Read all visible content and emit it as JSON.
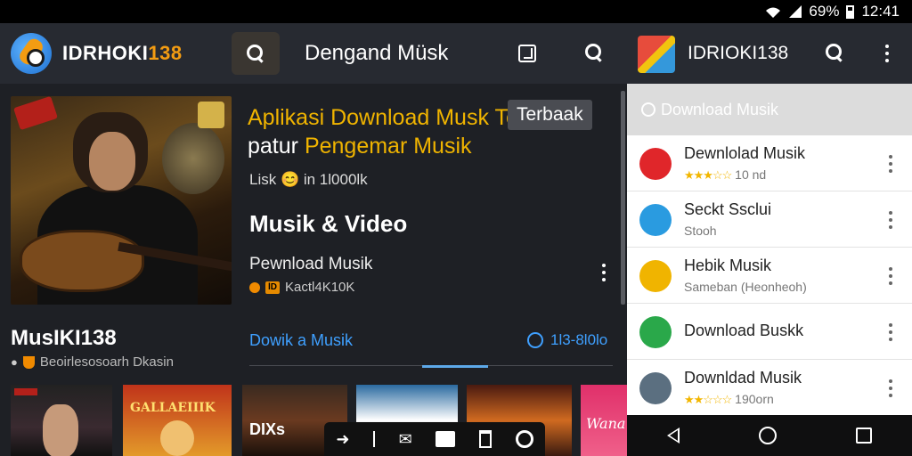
{
  "status_bar": {
    "battery": "69%",
    "time": "12:41"
  },
  "app_bar": {
    "brand_main": "IDRHOKI",
    "brand_accent": "138",
    "title": "Dengand Müsk",
    "brand2": "IDRIOKI138"
  },
  "hero": {
    "headline_line1": "Aplikasi Download Musk Ter",
    "headline_line2_white": "patur ",
    "headline_line2_orange": "Pengemar Musik",
    "pill": "Terbaak",
    "meta": "Lisk 😊 in 1l000lk",
    "section_title": "Musik & Video",
    "item_title": "Pewnload Musik",
    "item_sub": "Kactl4K10K",
    "item_badge": "lD"
  },
  "app_info": {
    "name": "MusIKI138",
    "sub": "Beoirlesosoarh Dkasin"
  },
  "links": {
    "left": "Dowik a Musik",
    "right": "1l3-8l0lo"
  },
  "thumbnails": [
    {
      "label": ""
    },
    {
      "label": "GALLAEIIIK"
    },
    {
      "label": "DIXs"
    },
    {
      "label": ""
    },
    {
      "label": ""
    },
    {
      "label": "Wana"
    }
  ],
  "panel": {
    "header": "Download Musik",
    "rows": [
      {
        "title": "Dewnlolad Musik",
        "sub": "10 nd",
        "stars": "★★★☆☆",
        "avatar_color": "#e0262a"
      },
      {
        "title": "Seckt Ssclui",
        "sub": "Stooh",
        "stars": "",
        "avatar_color": "#2a9be0"
      },
      {
        "title": "Hebik Musik",
        "sub": "Sameban (Heonheoh)",
        "stars": "",
        "avatar_color": "#f0b400"
      },
      {
        "title": "Download Buskk",
        "sub": "",
        "stars": "",
        "avatar_color": "#2aa84a"
      },
      {
        "title": "Downldad Musik",
        "sub": "190orn",
        "stars": "★★☆☆☆",
        "avatar_color": "#5b6f80"
      }
    ]
  },
  "colors": {
    "accent": "#f39c12",
    "link": "#3fa0ff",
    "panel_bg": "#ffffff"
  }
}
